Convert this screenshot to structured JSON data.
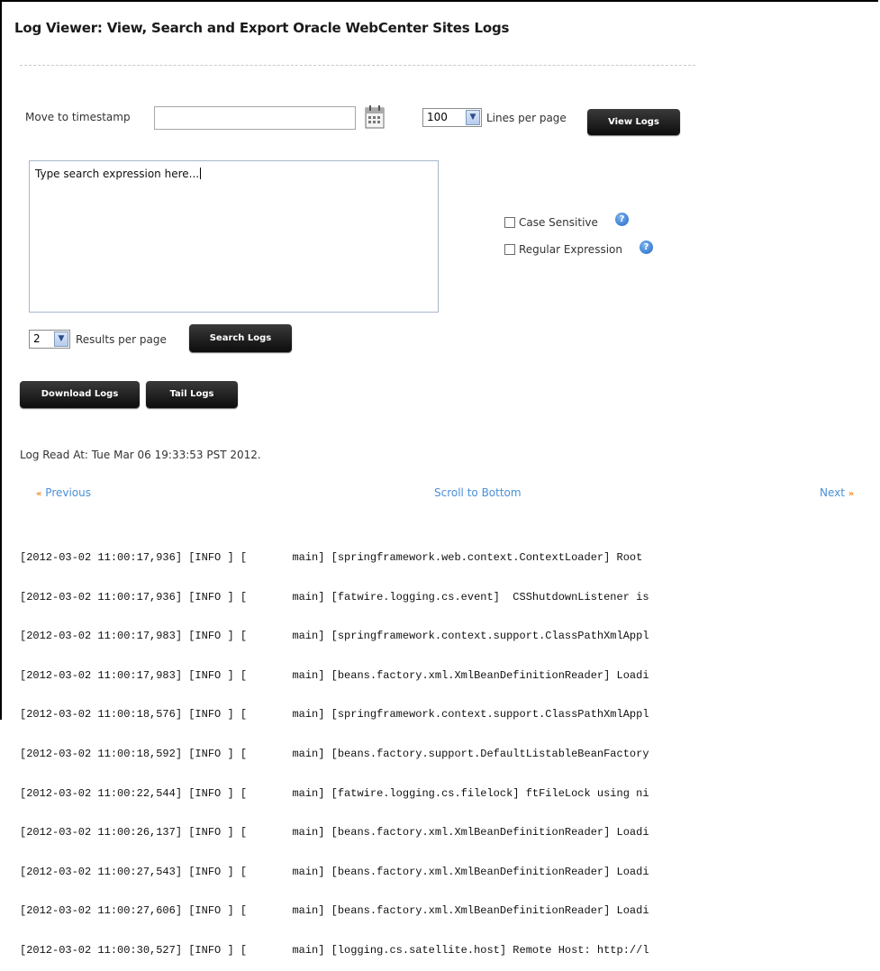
{
  "title": "Log Viewer: View, Search and Export Oracle WebCenter Sites Logs",
  "timestamp": {
    "label": "Move to timestamp",
    "value": "",
    "icon": "calendar-icon"
  },
  "lines_per_page": {
    "selected": "100",
    "label": "Lines per page"
  },
  "view_logs_label": "View Logs",
  "search": {
    "text": "Type search expression here...",
    "case_sensitive_label": "Case Sensitive",
    "case_sensitive_checked": false,
    "regex_label": "Regular Expression",
    "regex_checked": false,
    "help_icon": "help-icon"
  },
  "results_per_page": {
    "selected": "2",
    "label": "Results per page"
  },
  "search_logs_label": "Search Logs",
  "download_logs_label": "Download Logs",
  "tail_logs_label": "Tail Logs",
  "log_read_at": "Log Read At: Tue Mar 06 19:33:53 PST 2012.",
  "nav": {
    "previous": "Previous",
    "scroll_to_bottom": "Scroll to Bottom",
    "next": "Next"
  },
  "log_lines": [
    "[2012-03-02 11:00:17,936] [INFO ] [       main] [springframework.web.context.ContextLoader] Root",
    "[2012-03-02 11:00:17,936] [INFO ] [       main] [fatwire.logging.cs.event]  CSShutdownListener is",
    "[2012-03-02 11:00:17,983] [INFO ] [       main] [springframework.context.support.ClassPathXmlAppl",
    "[2012-03-02 11:00:17,983] [INFO ] [       main] [beans.factory.xml.XmlBeanDefinitionReader] Loadi",
    "[2012-03-02 11:00:18,576] [INFO ] [       main] [springframework.context.support.ClassPathXmlAppl",
    "[2012-03-02 11:00:18,592] [INFO ] [       main] [beans.factory.support.DefaultListableBeanFactory",
    "[2012-03-02 11:00:22,544] [INFO ] [       main] [fatwire.logging.cs.filelock] ftFileLock using ni",
    "[2012-03-02 11:00:26,137] [INFO ] [       main] [beans.factory.xml.XmlBeanDefinitionReader] Loadi",
    "[2012-03-02 11:00:27,543] [INFO ] [       main] [beans.factory.xml.XmlBeanDefinitionReader] Loadi",
    "[2012-03-02 11:00:27,606] [INFO ] [       main] [beans.factory.xml.XmlBeanDefinitionReader] Loadi",
    "[2012-03-02 11:00:30,527] [INFO ] [       main] [logging.cs.satellite.host] Remote Host: http://l"
  ]
}
